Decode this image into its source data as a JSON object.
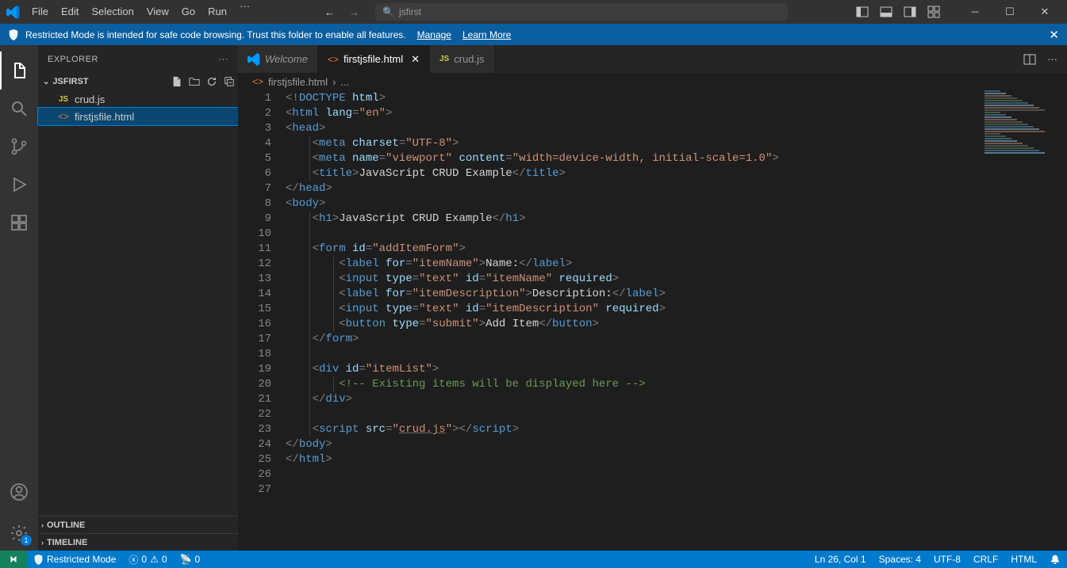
{
  "menu": {
    "items": [
      "File",
      "Edit",
      "Selection",
      "View",
      "Go",
      "Run"
    ]
  },
  "search": {
    "text": "jsfirst"
  },
  "banner": {
    "msg": "Restricted Mode is intended for safe code browsing. Trust this folder to enable all features.",
    "manage": "Manage",
    "learn": "Learn More"
  },
  "sidebar": {
    "title": "EXPLORER",
    "folder": "JSFIRST",
    "files": [
      {
        "icon": "JS",
        "name": "crud.js",
        "kind": "js"
      },
      {
        "icon": "<>",
        "name": "firstjsfile.html",
        "kind": "html"
      }
    ],
    "outline": "OUTLINE",
    "timeline": "TIMELINE"
  },
  "tabs": [
    {
      "icon": "vs",
      "label": "Welcome",
      "active": false,
      "close": false
    },
    {
      "icon": "<>",
      "label": "firstjsfile.html",
      "active": true,
      "close": true
    },
    {
      "icon": "JS",
      "label": "crud.js",
      "active": false,
      "close": false
    }
  ],
  "breadcrumbs": {
    "file": "firstjsfile.html",
    "sep": "›",
    "rest": "..."
  },
  "code_lines": 27,
  "status": {
    "restricted": "Restricted Mode",
    "errors": "0",
    "warnings": "0",
    "ports": "0",
    "cursor": "Ln 26, Col 1",
    "spaces": "Spaces: 4",
    "encoding": "UTF-8",
    "eol": "CRLF",
    "lang": "HTML"
  },
  "chart_data": null
}
